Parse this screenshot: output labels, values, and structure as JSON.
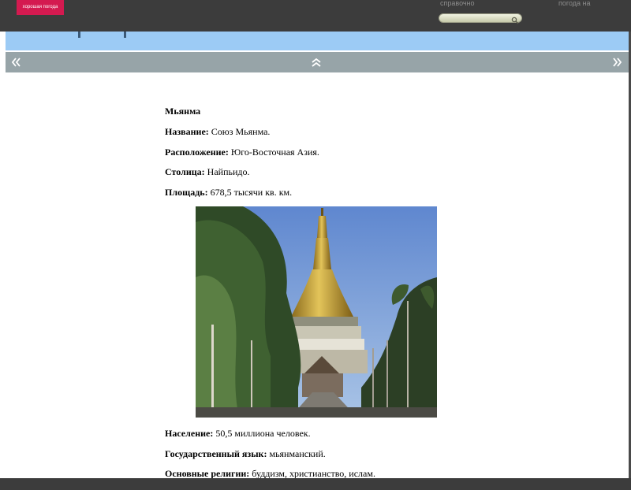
{
  "header": {
    "logo_text": "хорошая погода",
    "links": [
      "справочно",
      "погода на"
    ],
    "search": {
      "value": "",
      "placeholder": ""
    }
  },
  "icons": {
    "search": "magnifier-icon",
    "prev": "double-chevron-left-icon",
    "up": "double-chevron-up-icon",
    "next": "double-chevron-right-icon"
  },
  "colors": {
    "topbar": "#3c3c3c",
    "brand": "#d41a50",
    "band": "#9ccbf5",
    "navbar": "#97a4a8"
  },
  "article": {
    "country": "Мьянма",
    "rows": [
      {
        "label": "Название:",
        "value": " Союз Мьянма."
      },
      {
        "label": "Расположение:",
        "value": " Юго-Восточная Азия."
      },
      {
        "label": "Столица:",
        "value": " Найпьидо."
      },
      {
        "label": "Площадь:",
        "value": " 678,5 тысячи кв. км."
      },
      {
        "label": "Население:",
        "value": " 50,5 миллиона человек."
      },
      {
        "label": "Государственный язык:",
        "value": " мьянманский."
      },
      {
        "label": "Основные религии:",
        "value": " буддизм, христианство, ислам."
      }
    ]
  }
}
